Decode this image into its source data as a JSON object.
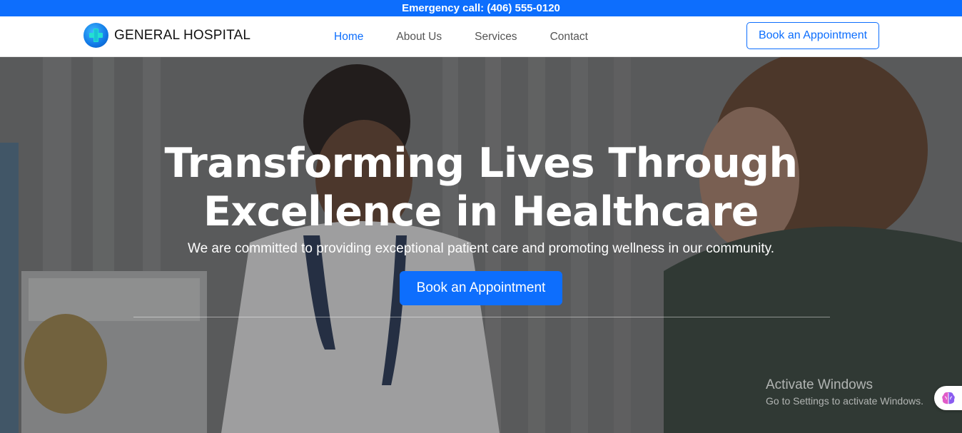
{
  "topbar": {
    "emergency": "Emergency call: (406) 555-0120"
  },
  "nav": {
    "brand": "GENERAL HOSPITAL",
    "links": [
      "Home",
      "About Us",
      "Services",
      "Contact"
    ],
    "active": "Home",
    "cta": "Book an Appointment"
  },
  "hero": {
    "title_line1": "Transforming Lives Through",
    "title_line2": "Excellence in Healthcare",
    "subtitle": "We are committed to providing exceptional patient care and promoting wellness in our community.",
    "cta": "Book an Appointment"
  },
  "watermark": {
    "title": "Activate Windows",
    "subtitle": "Go to Settings to activate Windows."
  },
  "colors": {
    "primary": "#0d6efd",
    "topbar_bg": "#0d6efd"
  },
  "icons": {
    "brand": "medical-cross-icon",
    "floating": "brain-icon"
  }
}
